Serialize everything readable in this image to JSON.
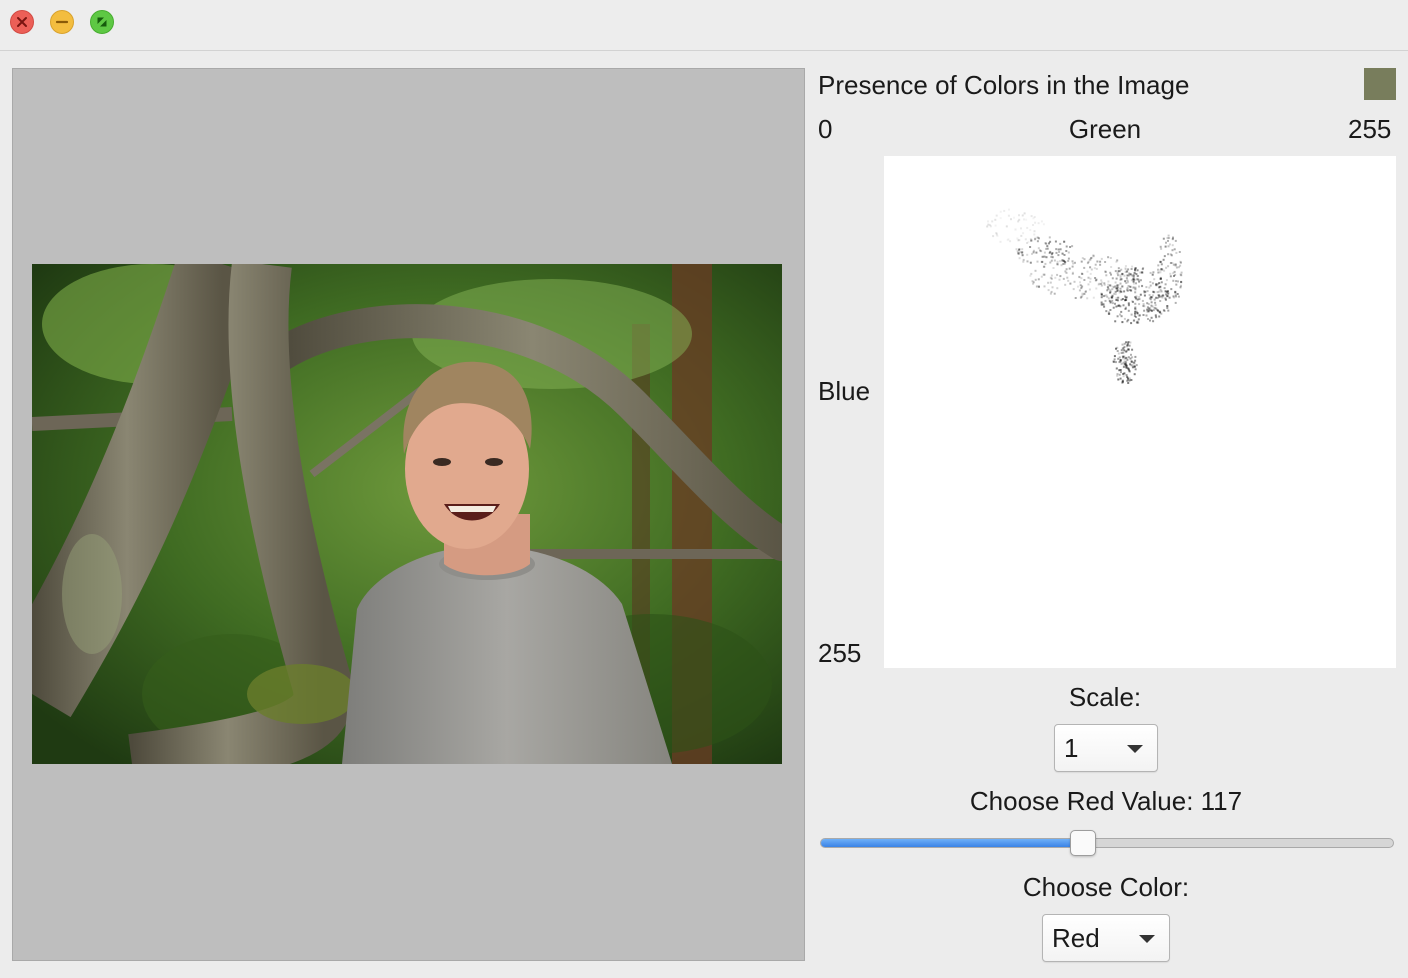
{
  "window": {
    "buttons": {
      "close": "close-icon",
      "minimize": "minimize-icon",
      "zoom": "zoom-icon"
    }
  },
  "histogram": {
    "title": "Presence of Colors in the Image",
    "selected_color": "#787d5c",
    "x_axis": {
      "min_label": "0",
      "label": "Green",
      "max_label": "255"
    },
    "y_axis": {
      "label": "Blue",
      "max_label": "255"
    }
  },
  "scale": {
    "label": "Scale:",
    "value": "1"
  },
  "red_slider": {
    "label": "Choose Red Value: 117",
    "value": 117,
    "min": 0,
    "max": 255
  },
  "color_choice": {
    "label": "Choose Color:",
    "value": "Red"
  }
}
